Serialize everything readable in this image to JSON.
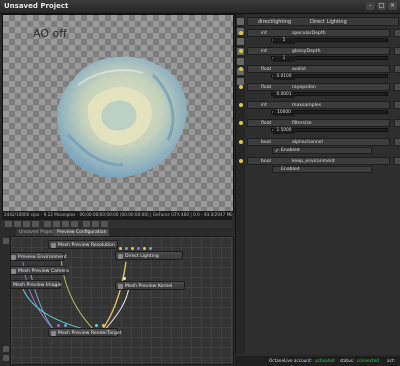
{
  "window": {
    "title": "Unsaved Project",
    "controls": [
      "-",
      "□",
      "×"
    ]
  },
  "viewport": {
    "ao_label": "AO off",
    "status_text": "2442/10000 s/px - 9.22 Msamples  - 00:00:00/00:00:00 (00:00:00:00) | GeForce GTX 460 | 0.0 - 93.0/2047 MB used"
  },
  "node_editor": {
    "tabs": [
      "Unsaved Project",
      "Preview Configuration"
    ],
    "nodes": [
      {
        "label": "Mesh Preview Resolution"
      },
      {
        "label": "Preview Environment"
      },
      {
        "label": "Mesh Preview Camera"
      },
      {
        "label": "Mesh Preview Imager"
      },
      {
        "label": "Direct Lighting"
      },
      {
        "label": "Mesh Preview Kernel"
      },
      {
        "label": "Mesh Preview RenderTarget"
      }
    ]
  },
  "panel": {
    "header": {
      "kind": "directlighting",
      "value": "Direct Lighting"
    },
    "params": [
      {
        "type": "int",
        "name": "specularDepth",
        "kind": "slider",
        "value": "5",
        "fill": 0.03,
        "ticks": [
          "",
          "",
          "",
          "",
          "1024"
        ]
      },
      {
        "type": "int",
        "name": "glossyDepth",
        "kind": "slider",
        "value": "1",
        "fill": 0.02,
        "ticks": [
          "",
          "",
          "",
          "",
          "1024"
        ]
      },
      {
        "type": "float",
        "name": "aodist",
        "kind": "slider",
        "value": "0.0100",
        "fill": 0.01,
        "ticks": [
          "",
          "",
          "",
          "",
          "1024"
        ]
      },
      {
        "type": "float",
        "name": "rayepsilon",
        "kind": "slider",
        "value": "0.0001",
        "fill": 0.0,
        "ticks": [
          "0.025",
          "0.05",
          "0.075",
          "0.1"
        ]
      },
      {
        "type": "int",
        "name": "maxsamples",
        "kind": "slider",
        "value": "10000",
        "fill": 0.1,
        "ticks": [
          "",
          "",
          "",
          "100000"
        ]
      },
      {
        "type": "float",
        "name": "filtersize",
        "kind": "slider",
        "value": "1.5000",
        "fill": 0.15,
        "ticks": [
          "2",
          "4",
          "6",
          "8"
        ]
      },
      {
        "type": "bool",
        "name": "alphachannel",
        "kind": "checkbox",
        "value": "Enabled",
        "checked": true
      },
      {
        "type": "bool",
        "name": "keep_environment",
        "kind": "checkbox",
        "value": "Enabled",
        "checked": false
      }
    ]
  },
  "footer": {
    "account_label": "OctaneLive account:",
    "account_status": "activated",
    "status_label": "status:",
    "status_value": "connected",
    "act_label": "act:"
  },
  "colors": {
    "connected": "#39c45a",
    "accent": "#d7c94b"
  }
}
